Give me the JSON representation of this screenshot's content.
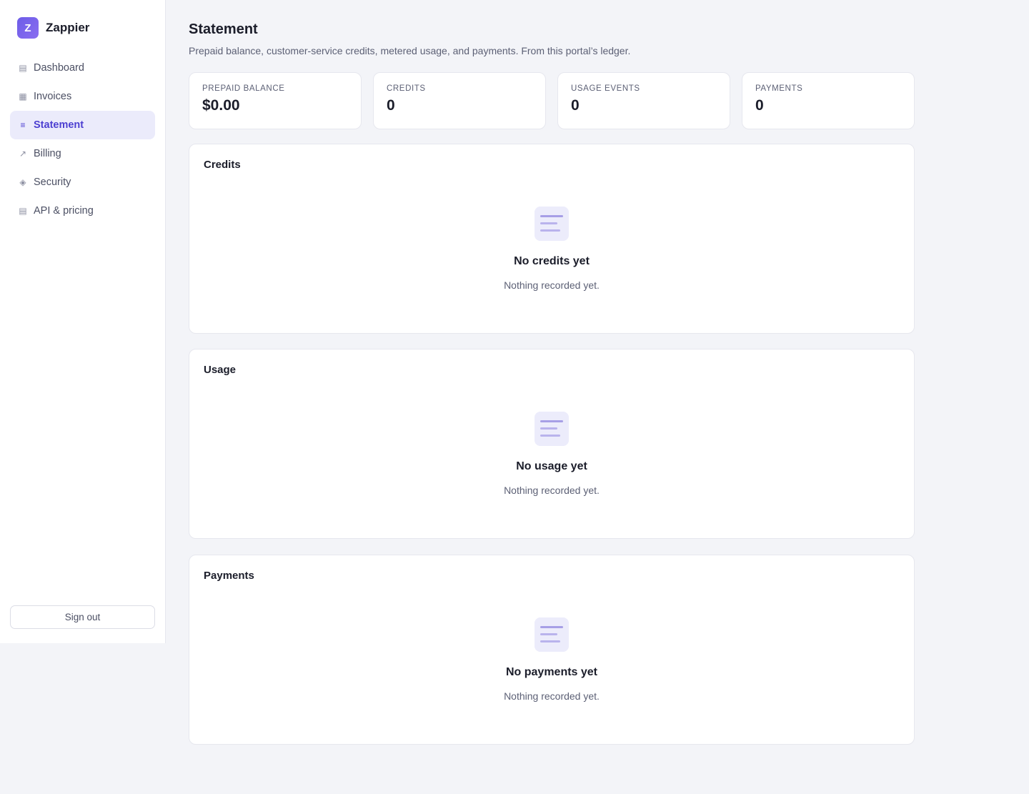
{
  "brand": {
    "logo_letter": "Z",
    "name": "Zappier"
  },
  "sidebar": {
    "items": [
      {
        "label": "Dashboard",
        "icon": "table-icon",
        "glyph": "▤",
        "active": false
      },
      {
        "label": "Invoices",
        "icon": "grid-icon",
        "glyph": "▦",
        "active": false
      },
      {
        "label": "Statement",
        "icon": "list-icon",
        "glyph": "≡",
        "active": true
      },
      {
        "label": "Billing",
        "icon": "trend-arrow-icon",
        "glyph": "↗",
        "active": false
      },
      {
        "label": "Security",
        "icon": "diamond-icon",
        "glyph": "◈",
        "active": false
      },
      {
        "label": "API & pricing",
        "icon": "table-icon",
        "glyph": "▤",
        "active": false
      }
    ],
    "signout_label": "Sign out"
  },
  "header": {
    "title": "Statement",
    "subtitle": "Prepaid balance, customer-service credits, metered usage, and payments. From this portal’s ledger."
  },
  "stats": [
    {
      "label": "PREPAID BALANCE",
      "value": "$0.00"
    },
    {
      "label": "CREDITS",
      "value": "0"
    },
    {
      "label": "USAGE EVENTS",
      "value": "0"
    },
    {
      "label": "PAYMENTS",
      "value": "0"
    }
  ],
  "sections": [
    {
      "title": "Credits",
      "empty_title": "No credits yet",
      "empty_text": "Nothing recorded yet."
    },
    {
      "title": "Usage",
      "empty_title": "No usage yet",
      "empty_text": "Nothing recorded yet."
    },
    {
      "title": "Payments",
      "empty_title": "No payments yet",
      "empty_text": "Nothing recorded yet."
    }
  ],
  "colors": {
    "accent": "#4c3fd1",
    "active_bg": "#ebebfb",
    "page_bg": "#f3f4f8"
  }
}
